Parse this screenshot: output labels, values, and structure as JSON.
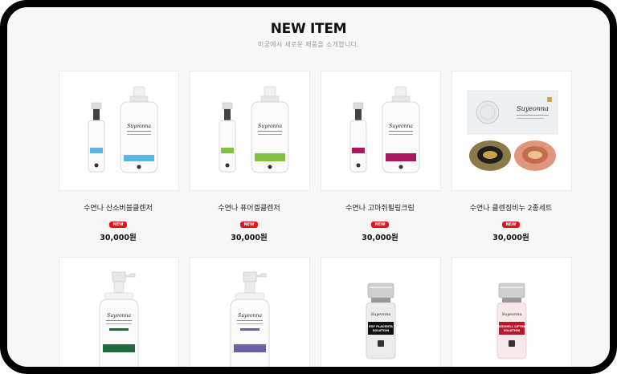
{
  "section": {
    "title": "NEW ITEM",
    "subtitle": "미궁에서 새로운 제품을 소개합니다."
  },
  "products": [
    {
      "name": "수연나 산소버블클렌저",
      "badge": "NEW",
      "price": "30,000원",
      "accent": "#5cb4e6"
    },
    {
      "name": "수연나 퓨어겔클렌저",
      "badge": "NEW",
      "price": "30,000원",
      "accent": "#7fc241"
    },
    {
      "name": "수연나 고마쥐필링크림",
      "badge": "NEW",
      "price": "30,000원",
      "accent": "#a8185a"
    },
    {
      "name": "수연나 클렌징비누 2종세트",
      "badge": "NEW",
      "price": "30,000원",
      "accent": "#c9a24a"
    },
    {
      "accent": "#1f6b3b"
    },
    {
      "accent": "#6b5fa8"
    },
    {
      "label": "EGF PLACENTA SOLUTION",
      "accent": "#111111"
    },
    {
      "label": "EGGSHELL LIFTING SOLUTION",
      "accent": "#b8182a"
    }
  ]
}
